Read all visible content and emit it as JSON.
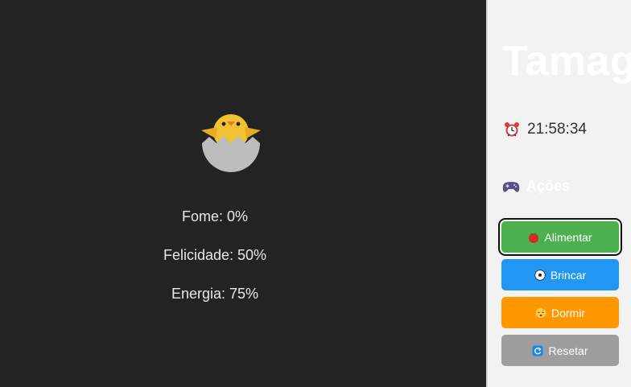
{
  "pet": {
    "icon": "hatching-chick-icon"
  },
  "stats": [
    {
      "label": "Fome: 0%",
      "value": 0
    },
    {
      "label": "Felicidade: 50%",
      "value": 50
    },
    {
      "label": "Energia: 75%",
      "value": 75
    }
  ],
  "panel": {
    "title": "Tamag",
    "clock": {
      "icon": "alarm-clock-icon",
      "time": "21:58:34"
    },
    "section": {
      "icon": "game-controller-icon",
      "label": "Ações"
    },
    "buttons": [
      {
        "label": "Alimentar",
        "icon": "tomato-icon",
        "color": "#4caf50"
      },
      {
        "label": "Brincar",
        "icon": "soccer-ball-icon",
        "color": "#2196f3"
      },
      {
        "label": "Dormir",
        "icon": "sleeping-face-icon",
        "color": "#ff9800"
      },
      {
        "label": "Resetar",
        "icon": "refresh-icon",
        "color": "#9e9e9e"
      }
    ]
  }
}
